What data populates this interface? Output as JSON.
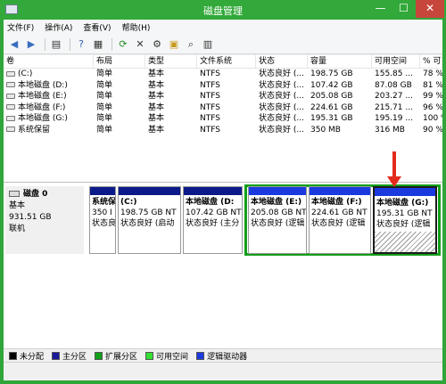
{
  "window": {
    "title": "磁盘管理",
    "min": "—",
    "max": "☐",
    "close": "✕"
  },
  "menu": [
    "文件(F)",
    "操作(A)",
    "查看(V)",
    "帮助(H)"
  ],
  "toolbar_icons": [
    "back-icon",
    "forward-icon",
    "console-tree-icon",
    "help-icon",
    "properties-icon",
    "refresh-icon",
    "delete-icon",
    "settings-icon",
    "open-icon",
    "search-icon",
    "view-icon"
  ],
  "list": {
    "columns": [
      "卷",
      "布局",
      "类型",
      "文件系统",
      "状态",
      "容量",
      "可用空间",
      "% 可"
    ],
    "rows": [
      [
        "(C:)",
        "简单",
        "基本",
        "NTFS",
        "状态良好 (...",
        "198.75 GB",
        "155.85 ...",
        "78 %"
      ],
      [
        "本地磁盘 (D:)",
        "简单",
        "基本",
        "NTFS",
        "状态良好 (...",
        "107.42 GB",
        "87.08 GB",
        "81 %"
      ],
      [
        "本地磁盘 (E:)",
        "简单",
        "基本",
        "NTFS",
        "状态良好 (...",
        "205.08 GB",
        "203.27 ...",
        "99 %"
      ],
      [
        "本地磁盘 (F:)",
        "简单",
        "基本",
        "NTFS",
        "状态良好 (...",
        "224.61 GB",
        "215.71 ...",
        "96 %"
      ],
      [
        "本地磁盘 (G:)",
        "简单",
        "基本",
        "NTFS",
        "状态良好 (...",
        "195.31 GB",
        "195.19 ...",
        "100 %"
      ],
      [
        "系统保留",
        "简单",
        "基本",
        "NTFS",
        "状态良好 (...",
        "350 MB",
        "316 MB",
        "90 %"
      ]
    ]
  },
  "disk": {
    "name": "磁盘 0",
    "type": "基本",
    "size": "931.51 GB",
    "status": "联机"
  },
  "partitions": [
    {
      "label": "系统保",
      "size": "350 I",
      "status": "状态良"
    },
    {
      "label": "(C:)",
      "size": "198.75 GB NT",
      "status": "状态良好 (启动"
    },
    {
      "label": "本地磁盘 (D:",
      "size": "107.42 GB NT",
      "status": "状态良好 (主分"
    },
    {
      "label": "本地磁盘 (E:)",
      "size": "205.08 GB NT",
      "status": "状态良好 (逻辑"
    },
    {
      "label": "本地磁盘 (F:)",
      "size": "224.61 GB NT",
      "status": "状态良好 (逻辑"
    },
    {
      "label": "本地磁盘 (G:)",
      "size": "195.31 GB NT",
      "status": "状态良好 (逻辑"
    }
  ],
  "legend": [
    {
      "label": "未分配",
      "color": "#000000"
    },
    {
      "label": "主分区",
      "color": "#1a1a9a"
    },
    {
      "label": "扩展分区",
      "color": "#12a01a"
    },
    {
      "label": "可用空间",
      "color": "#33e033"
    },
    {
      "label": "逻辑驱动器",
      "color": "#1a3ae0"
    }
  ],
  "colors": {
    "primary_bar": "#0b1a8a",
    "logical_bar": "#1a3ae0",
    "extended_border": "#12a01a",
    "annotation_arrow": "#e32b1b"
  }
}
